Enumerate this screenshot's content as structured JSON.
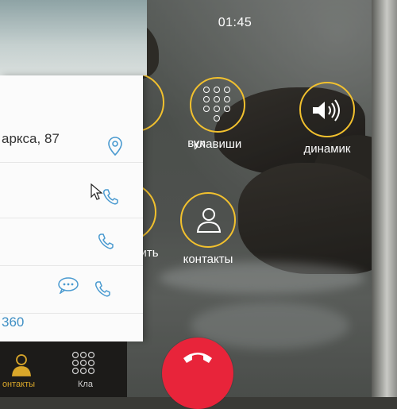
{
  "call": {
    "timer": "01:45",
    "actions": {
      "sound_partial": "вук",
      "keypad": "клавиши",
      "speaker": "динамик",
      "hold_partial": "ить",
      "contacts": "контакты"
    }
  },
  "contact_card": {
    "address": "аркса, 87",
    "number_partial": "360"
  },
  "tabbar": {
    "contacts": "онтакты",
    "keypad": "Кла"
  },
  "colors": {
    "accent": "#f2c12e",
    "end_call": "#e8243a",
    "link_blue": "#3f8fc4",
    "tab_active": "#d9a72a"
  }
}
